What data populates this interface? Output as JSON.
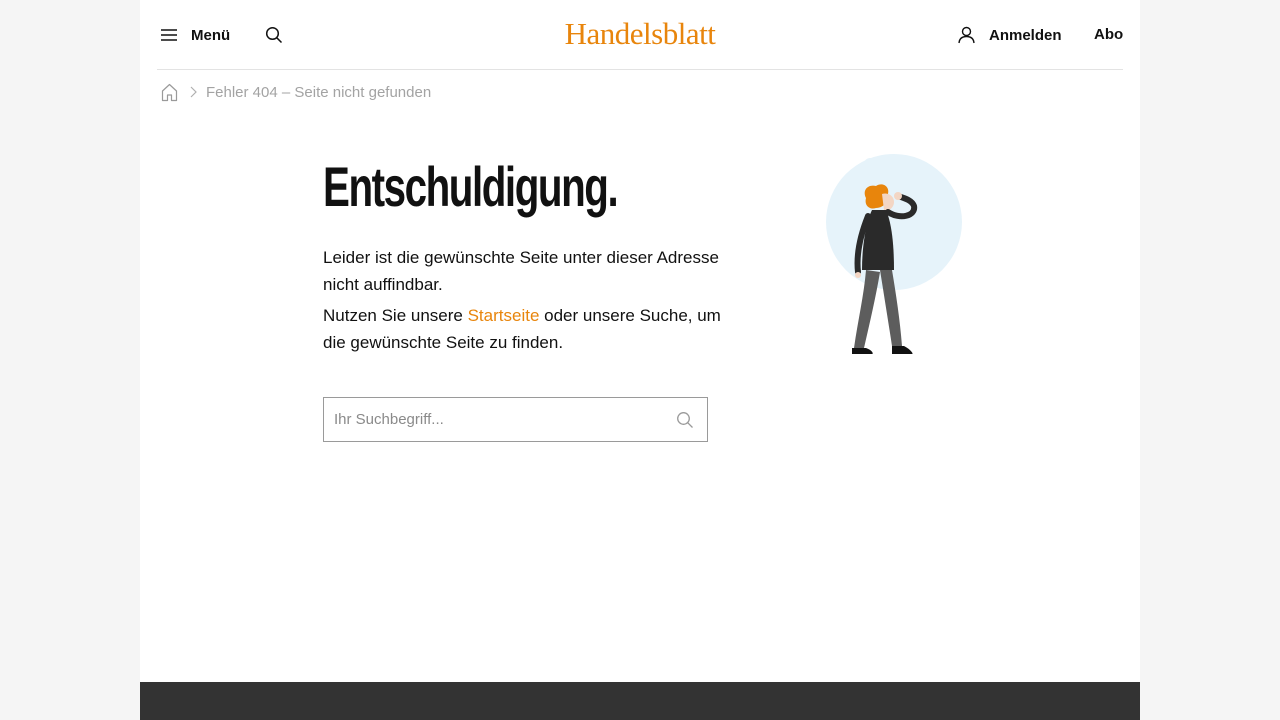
{
  "header": {
    "menu_label": "Menü",
    "logo_text": "Handelsblatt",
    "login_label": "Anmelden",
    "abo_label": "Abo"
  },
  "breadcrumb": {
    "home_icon": "home-icon",
    "separator_icon": "chevron-right-icon",
    "current": "Fehler 404 – Seite nicht gefunden"
  },
  "main": {
    "headline": "Entschuldigung.",
    "paragraph1": "Leider ist die gewünschte Seite unter dieser Adresse nicht auffindbar.",
    "paragraph2_before": "Nutzen Sie unsere ",
    "paragraph2_link": "Startseite",
    "paragraph2_after": " oder unsere Suche, um die gewünschte Seite zu finden.",
    "search_placeholder": "Ihr Suchbegriff..."
  },
  "colors": {
    "brand": "#e8850c",
    "text": "#111111",
    "muted": "#a3a3a3",
    "page_bg": "#f5f5f5",
    "footer_bg": "#333333"
  }
}
